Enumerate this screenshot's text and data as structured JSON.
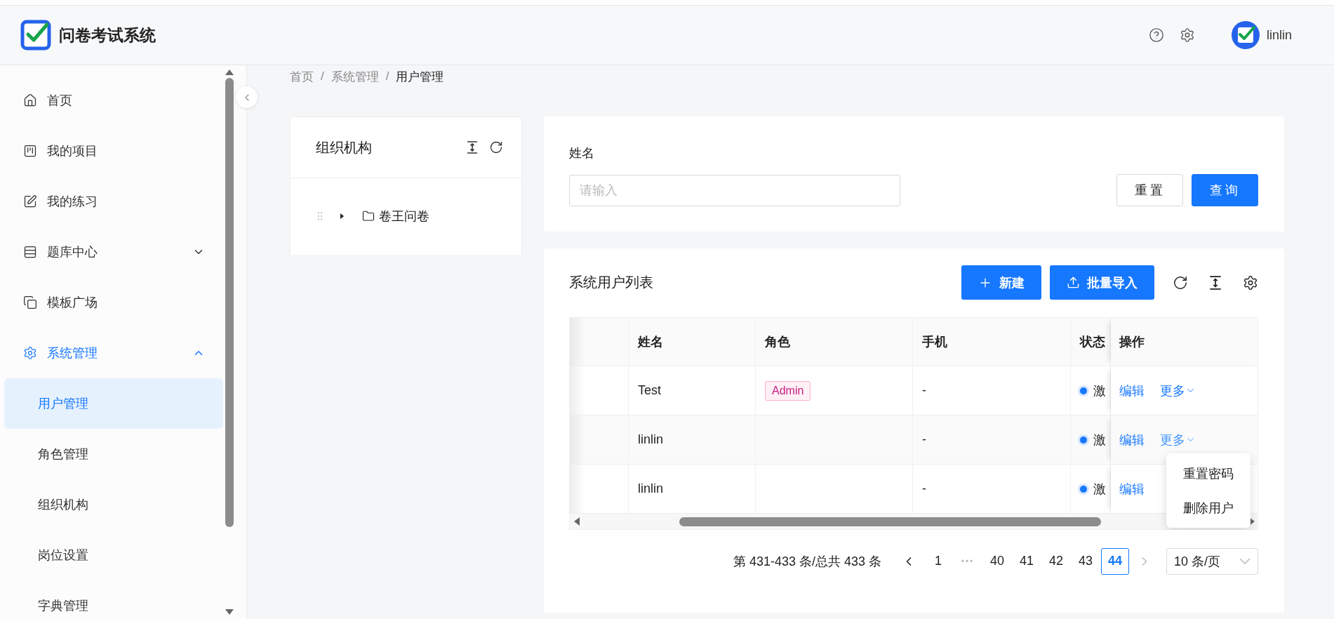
{
  "header": {
    "title": "问卷考试系统",
    "user": "linlin"
  },
  "sidebar": {
    "items": [
      {
        "label": "首页",
        "selected": false
      },
      {
        "label": "我的项目",
        "selected": false
      },
      {
        "label": "我的练习",
        "selected": false
      },
      {
        "label": "题库中心",
        "selected": false,
        "expanded": false
      },
      {
        "label": "模板广场",
        "selected": false
      },
      {
        "label": "系统管理",
        "selected": false,
        "expanded": true,
        "children": [
          {
            "label": "用户管理",
            "selected": true
          },
          {
            "label": "角色管理",
            "selected": false
          },
          {
            "label": "组织机构",
            "selected": false
          },
          {
            "label": "岗位设置",
            "selected": false
          },
          {
            "label": "字典管理",
            "selected": false
          }
        ]
      }
    ]
  },
  "breadcrumb": {
    "separator": "/",
    "items": [
      "首页",
      "系统管理",
      "用户管理"
    ]
  },
  "org_panel": {
    "title": "组织机构",
    "tree": [
      {
        "label": "卷王问卷",
        "expanded": false
      }
    ]
  },
  "search": {
    "field_label": "姓名",
    "placeholder": "请输入",
    "buttons": [
      "重置",
      "查询"
    ]
  },
  "user_list": {
    "title": "系统用户列表",
    "buttons": [
      "新建",
      "批量导入"
    ],
    "table": {
      "columns": [
        "姓名",
        "角色",
        "手机",
        "状态",
        "操作"
      ],
      "rows": [
        {
          "name": "Test",
          "role": "Admin",
          "phone": "-",
          "status": "激",
          "edit": "编辑",
          "more": "更多",
          "menu_open": false
        },
        {
          "name": "linlin",
          "phone": "-",
          "status": "激",
          "edit": "编辑",
          "more": "更多",
          "menu_open": true
        },
        {
          "name": "linlin",
          "phone": "-",
          "status": "激",
          "edit": "编辑",
          "menu_open": false
        }
      ],
      "more_menu": [
        "重置密码",
        "删除用户"
      ]
    },
    "pagination": {
      "summary": "第 431-433 条/总共 433 条",
      "prev_disabled": false,
      "next_disabled": true,
      "pages": [
        {
          "kind": "page",
          "label": "1",
          "selected": false
        },
        {
          "kind": "ellipsis",
          "label": "•••",
          "selected": false
        },
        {
          "kind": "page",
          "label": "40",
          "selected": false
        },
        {
          "kind": "page",
          "label": "41",
          "selected": false
        },
        {
          "kind": "page",
          "label": "42",
          "selected": false
        },
        {
          "kind": "page",
          "label": "43",
          "selected": false
        },
        {
          "kind": "page",
          "label": "44",
          "selected": true
        }
      ],
      "page_size": "10 条/页"
    }
  }
}
